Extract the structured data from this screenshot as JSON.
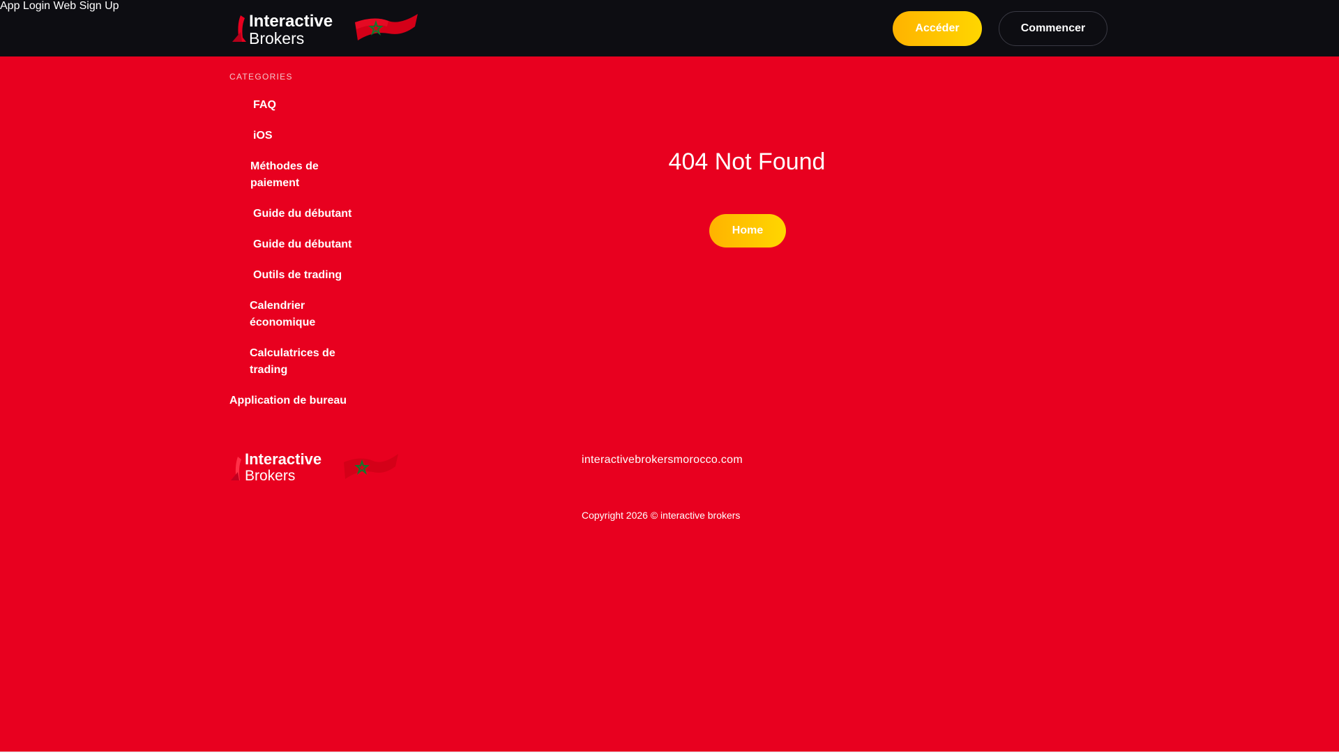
{
  "header": {
    "logo_line1": "Interactive",
    "logo_line2": "Brokers",
    "nav": [
      "App",
      "Login",
      "Web",
      "Sign Up"
    ],
    "btn_primary": "Accéder",
    "btn_secondary": "Commencer"
  },
  "sidebar": {
    "heading": "CATEGORIES",
    "items": [
      {
        "label": "FAQ"
      },
      {
        "label": "iOS"
      },
      {
        "label": "Méthodes de paiement"
      },
      {
        "label": "Guide du débutant"
      },
      {
        "label": "Guide du débutant"
      },
      {
        "label": "Outils de trading"
      },
      {
        "label": "Calendrier économique"
      },
      {
        "label": "Calculatrices de trading"
      },
      {
        "label": "Application de bureau"
      }
    ]
  },
  "main": {
    "title": "404 Not Found",
    "home_button": "Home"
  },
  "footer": {
    "logo_line1": "Interactive",
    "logo_line2": "Brokers",
    "domain": "interactivebrokersmorocco.com",
    "copyright": "Copyright 2026 © interactive brokers"
  },
  "colors": {
    "background": "#e8001f",
    "header": "#0d0d12",
    "accent": "#ffc400"
  },
  "icons": [
    "interactive-brokers-logo-icon",
    "morocco-flag-icon"
  ]
}
